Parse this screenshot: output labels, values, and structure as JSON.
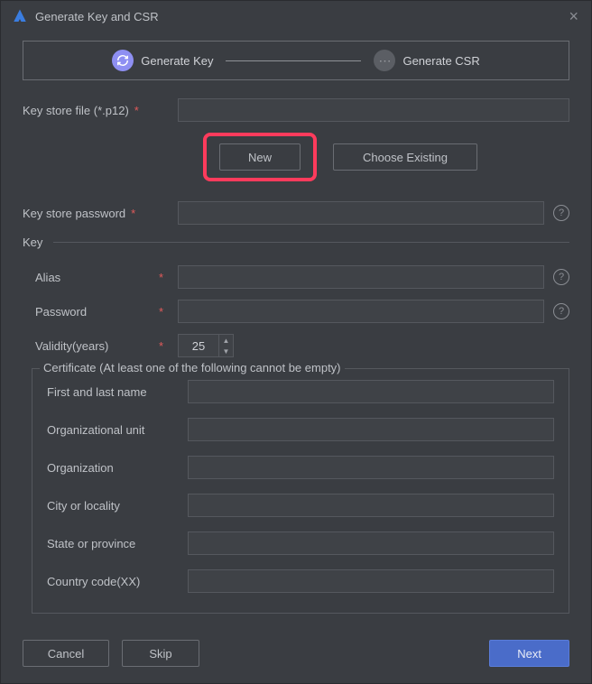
{
  "window": {
    "title": "Generate Key and CSR"
  },
  "stepper": {
    "step1": "Generate Key",
    "step2": "Generate CSR"
  },
  "labels": {
    "keystore_file": "Key store file (*.p12)",
    "keystore_password": "Key store password",
    "key_section": "Key",
    "alias": "Alias",
    "password": "Password",
    "validity": "Validity(years)",
    "cert_legend": "Certificate (At least one of the following cannot be empty)",
    "first_last": "First and last name",
    "org_unit": "Organizational unit",
    "organization": "Organization",
    "city": "City or locality",
    "state": "State or province",
    "country": "Country code(XX)"
  },
  "buttons": {
    "new": "New",
    "choose_existing": "Choose Existing",
    "cancel": "Cancel",
    "skip": "Skip",
    "next": "Next"
  },
  "values": {
    "keystore_file": "",
    "keystore_password": "",
    "alias": "",
    "password": "",
    "validity": "25",
    "first_last": "",
    "org_unit": "",
    "organization": "",
    "city": "",
    "state": "",
    "country": ""
  },
  "required_marker": "*"
}
